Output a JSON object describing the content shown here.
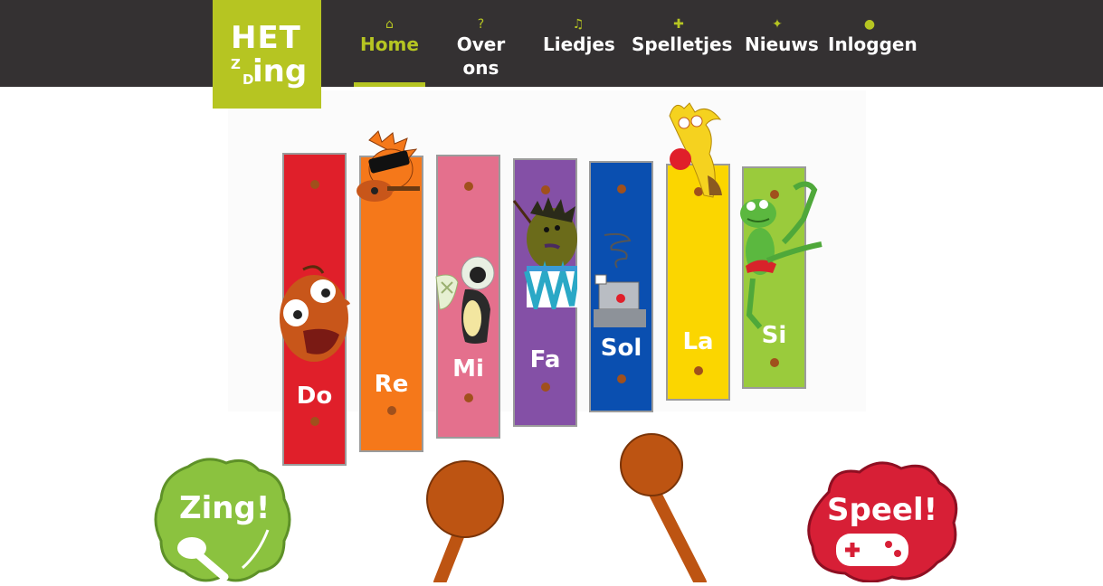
{
  "header": {
    "logo": {
      "line1": "HET",
      "z": "Z",
      "d": "D",
      "ing": "ing"
    },
    "nav": [
      {
        "label": "Home",
        "icon": "home-icon",
        "glyph": "⌂",
        "active": true
      },
      {
        "label": "Over ons",
        "icon": "question-icon",
        "glyph": "?",
        "active": false
      },
      {
        "label": "Liedjes",
        "icon": "music-note-icon",
        "glyph": "♫",
        "active": false
      },
      {
        "label": "Spelletjes",
        "icon": "puzzle-icon",
        "glyph": "✚",
        "active": false
      },
      {
        "label": "Nieuws",
        "icon": "megaphone-icon",
        "glyph": "✦",
        "active": false
      },
      {
        "label": "Inloggen",
        "icon": "user-icon",
        "glyph": "●",
        "active": false
      }
    ]
  },
  "xylophone": {
    "bars": [
      {
        "note": "Do",
        "color": "#e01f2a"
      },
      {
        "note": "Re",
        "color": "#f5781a"
      },
      {
        "note": "Mi",
        "color": "#e4708d"
      },
      {
        "note": "Fa",
        "color": "#8450a6"
      },
      {
        "note": "Sol",
        "color": "#0a4fb0"
      },
      {
        "note": "La",
        "color": "#fbd600"
      },
      {
        "note": "Si",
        "color": "#9acb3c"
      }
    ]
  },
  "actions": {
    "zing": {
      "label": "Zing!",
      "color": "#8bc23f"
    },
    "speel": {
      "label": "Speel!",
      "color": "#d71f36"
    }
  },
  "colors": {
    "accent": "#b6c522",
    "header_bg": "#343132",
    "mallet": "#bd5412"
  }
}
